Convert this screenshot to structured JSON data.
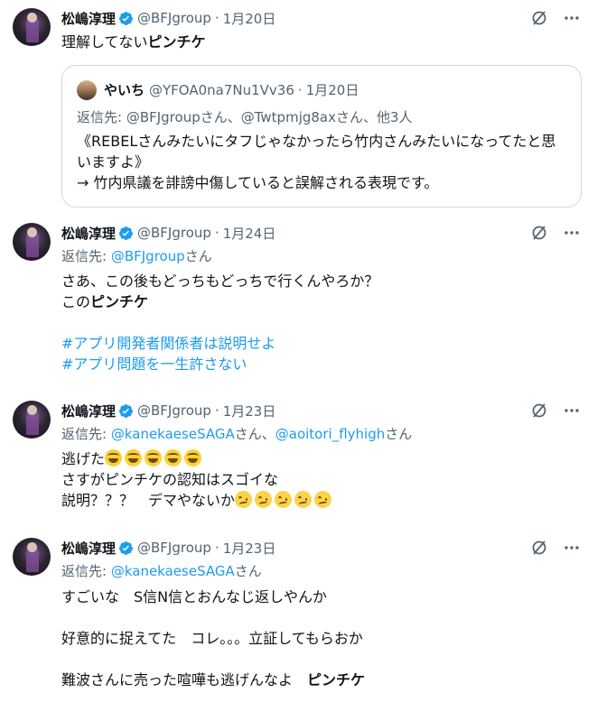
{
  "colors": {
    "text": "#0f1419",
    "muted": "#536471",
    "link": "#1d9bf0",
    "verified": "#1d9bf0",
    "border": "#cfd9de"
  },
  "icons": [
    "avatar",
    "verified-badge-icon",
    "grok-slash-icon",
    "more-dots-icon",
    "face-with-tears-of-joy-emoji",
    "woozy-face-emoji"
  ],
  "tweets": [
    {
      "name": "松嶋淳理",
      "handle": "@BFJgroup",
      "sep": "·",
      "date": "1月20日",
      "line1_pre": "理解してない",
      "line1_bold": "ピンチケ",
      "quote": {
        "name": "やいち",
        "handle": "@YFOA0na7Nu1Vv36",
        "sep": "·",
        "date": "1月20日",
        "reply_text": "返信先: @BFJgroupさん、@Twtpmjg8axさん、他3人",
        "lines": [
          "《REBELさんみたいにタフじゃなかったら竹内さんみたいになってたと思",
          "いますよ》",
          "→ 竹内県議を誹謗中傷していると誤解される表現です。"
        ]
      }
    },
    {
      "name": "松嶋淳理",
      "handle": "@BFJgroup",
      "sep": "·",
      "date": "1月24日",
      "reply_prefix": "返信先: ",
      "reply_link": "@BFJgroup",
      "reply_suffix": "さん",
      "line1": "さあ、この後もどっちもどっちで行くんやろか？",
      "line2_pre": "この",
      "line2_bold": "ピンチケ",
      "hashtag1": "#アプリ開発者関係者は説明せよ",
      "hashtag2": "#アプリ問題を一生許さない"
    },
    {
      "name": "松嶋淳理",
      "handle": "@BFJgroup",
      "sep": "·",
      "date": "1月23日",
      "reply_prefix": "返信先: ",
      "reply_link1": "@kanekaeseSAGA",
      "reply_mid": "さん、",
      "reply_link2": "@aoitori_flyhigh",
      "reply_suffix": "さん",
      "line1": "逃げた",
      "line2": "さすがピンチケの認知はスゴイな",
      "line3": "説明？？？　デマやないか"
    },
    {
      "name": "松嶋淳理",
      "handle": "@BFJgroup",
      "sep": "·",
      "date": "1月23日",
      "reply_prefix": "返信先: ",
      "reply_link": "@kanekaeseSAGA",
      "reply_suffix": "さん",
      "line1": "すごいな　S信N信とおんなじ返しやんか",
      "line2": "好意的に捉えてた　コレ。。。立証してもらおか",
      "line3_pre": "難波さんに売った喧嘩も逃げんなよ　",
      "line3_bold": "ピンチケ"
    }
  ]
}
